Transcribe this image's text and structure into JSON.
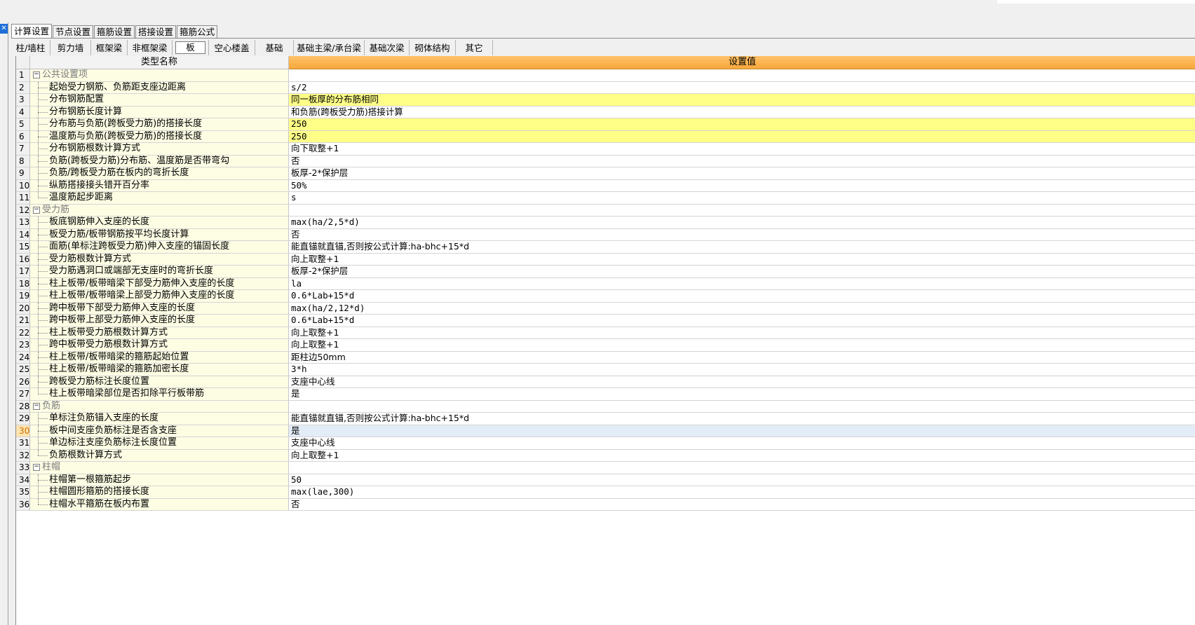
{
  "tabs": [
    {
      "label": "计算设置",
      "active": true
    },
    {
      "label": "节点设置",
      "active": false
    },
    {
      "label": "箍筋设置",
      "active": false
    },
    {
      "label": "搭接设置",
      "active": false
    },
    {
      "label": "箍筋公式",
      "active": false
    }
  ],
  "toolbar": [
    {
      "label": "柱/墙柱",
      "width": 56
    },
    {
      "label": "剪力墙",
      "width": 58
    },
    {
      "label": "框架梁",
      "width": 52
    },
    {
      "label": "非框架梁",
      "width": 64
    },
    {
      "label": "板",
      "width": 52,
      "active": true
    },
    {
      "label": "空心楼盖",
      "width": 66
    },
    {
      "label": "基础",
      "width": 55
    },
    {
      "label": "基础主梁/承台梁",
      "width": 101
    },
    {
      "label": "基础次梁",
      "width": 64
    },
    {
      "label": "砌体结构",
      "width": 66
    },
    {
      "label": "其它",
      "width": 53
    }
  ],
  "grid": {
    "col_name_header": "类型名称",
    "col_value_header": "设置值",
    "rows": [
      {
        "num": "1",
        "type": "group",
        "name": "公共设置项",
        "value": ""
      },
      {
        "num": "2",
        "type": "item",
        "name": "起始受力钢筋、负筋距支座边距离",
        "value": "s/2"
      },
      {
        "num": "3",
        "type": "item",
        "name": "分布钢筋配置",
        "value": "同一板厚的分布筋相同",
        "highlight": "yellow"
      },
      {
        "num": "4",
        "type": "item",
        "name": "分布钢筋长度计算",
        "value": "和负筋(跨板受力筋)搭接计算"
      },
      {
        "num": "5",
        "type": "item",
        "name": "分布筋与负筋(跨板受力筋)的搭接长度",
        "value": "250",
        "highlight": "yellow"
      },
      {
        "num": "6",
        "type": "item",
        "name": "温度筋与负筋(跨板受力筋)的搭接长度",
        "value": "250",
        "highlight": "yellow"
      },
      {
        "num": "7",
        "type": "item",
        "name": "分布钢筋根数计算方式",
        "value": "向下取整+1"
      },
      {
        "num": "8",
        "type": "item",
        "name": "负筋(跨板受力筋)分布筋、温度筋是否带弯勾",
        "value": "否"
      },
      {
        "num": "9",
        "type": "item",
        "name": "负筋/跨板受力筋在板内的弯折长度",
        "value": "板厚-2*保护层"
      },
      {
        "num": "10",
        "type": "item",
        "name": "纵筋搭接接头错开百分率",
        "value": "50%"
      },
      {
        "num": "11",
        "type": "item",
        "name": "温度筋起步距离",
        "value": "s"
      },
      {
        "num": "12",
        "type": "group",
        "name": "受力筋",
        "value": ""
      },
      {
        "num": "13",
        "type": "item",
        "name": "板底钢筋伸入支座的长度",
        "value": "max(ha/2,5*d)"
      },
      {
        "num": "14",
        "type": "item",
        "name": "板受力筋/板带钢筋按平均长度计算",
        "value": "否"
      },
      {
        "num": "15",
        "type": "item",
        "name": "面筋(单标注跨板受力筋)伸入支座的锚固长度",
        "value": "能直锚就直锚,否则按公式计算:ha-bhc+15*d"
      },
      {
        "num": "16",
        "type": "item",
        "name": "受力筋根数计算方式",
        "value": "向上取整+1"
      },
      {
        "num": "17",
        "type": "item",
        "name": "受力筋遇洞口或端部无支座时的弯折长度",
        "value": "板厚-2*保护层"
      },
      {
        "num": "18",
        "type": "item",
        "name": "柱上板带/板带暗梁下部受力筋伸入支座的长度",
        "value": "la"
      },
      {
        "num": "19",
        "type": "item",
        "name": "柱上板带/板带暗梁上部受力筋伸入支座的长度",
        "value": "0.6*Lab+15*d"
      },
      {
        "num": "20",
        "type": "item",
        "name": "跨中板带下部受力筋伸入支座的长度",
        "value": "max(ha/2,12*d)"
      },
      {
        "num": "21",
        "type": "item",
        "name": "跨中板带上部受力筋伸入支座的长度",
        "value": "0.6*Lab+15*d"
      },
      {
        "num": "22",
        "type": "item",
        "name": "柱上板带受力筋根数计算方式",
        "value": "向上取整+1"
      },
      {
        "num": "23",
        "type": "item",
        "name": "跨中板带受力筋根数计算方式",
        "value": "向上取整+1"
      },
      {
        "num": "24",
        "type": "item",
        "name": "柱上板带/板带暗梁的箍筋起始位置",
        "value": "距柱边50mm"
      },
      {
        "num": "25",
        "type": "item",
        "name": "柱上板带/板带暗梁的箍筋加密长度",
        "value": "3*h"
      },
      {
        "num": "26",
        "type": "item",
        "name": "跨板受力筋标注长度位置",
        "value": "支座中心线"
      },
      {
        "num": "27",
        "type": "item",
        "name": "柱上板带暗梁部位是否扣除平行板带筋",
        "value": "是"
      },
      {
        "num": "28",
        "type": "group",
        "name": "负筋",
        "value": ""
      },
      {
        "num": "29",
        "type": "item",
        "name": "单标注负筋锚入支座的长度",
        "value": "能直锚就直锚,否则按公式计算:ha-bhc+15*d"
      },
      {
        "num": "30",
        "type": "item",
        "name": "板中间支座负筋标注是否含支座",
        "value": "是",
        "selected": true
      },
      {
        "num": "31",
        "type": "item",
        "name": "单边标注支座负筋标注长度位置",
        "value": "支座中心线"
      },
      {
        "num": "32",
        "type": "item",
        "name": "负筋根数计算方式",
        "value": "向上取整+1"
      },
      {
        "num": "33",
        "type": "group",
        "name": "柱帽",
        "value": ""
      },
      {
        "num": "34",
        "type": "item",
        "name": "柱帽第一根箍筋起步",
        "value": "50"
      },
      {
        "num": "35",
        "type": "item",
        "name": "柱帽圆形箍筋的搭接长度",
        "value": "max(lae,300)"
      },
      {
        "num": "36",
        "type": "item",
        "name": "柱帽水平箍筋在板内布置",
        "value": "否"
      }
    ]
  },
  "icons": {
    "expander": "minus-box-icon",
    "close": "close-icon"
  },
  "colors": {
    "header_value_bg": "#f8a73a",
    "name_col_bg": "#fdfde4",
    "highlight_yellow": "#ffff88",
    "selected_row": "#e3edf8"
  }
}
